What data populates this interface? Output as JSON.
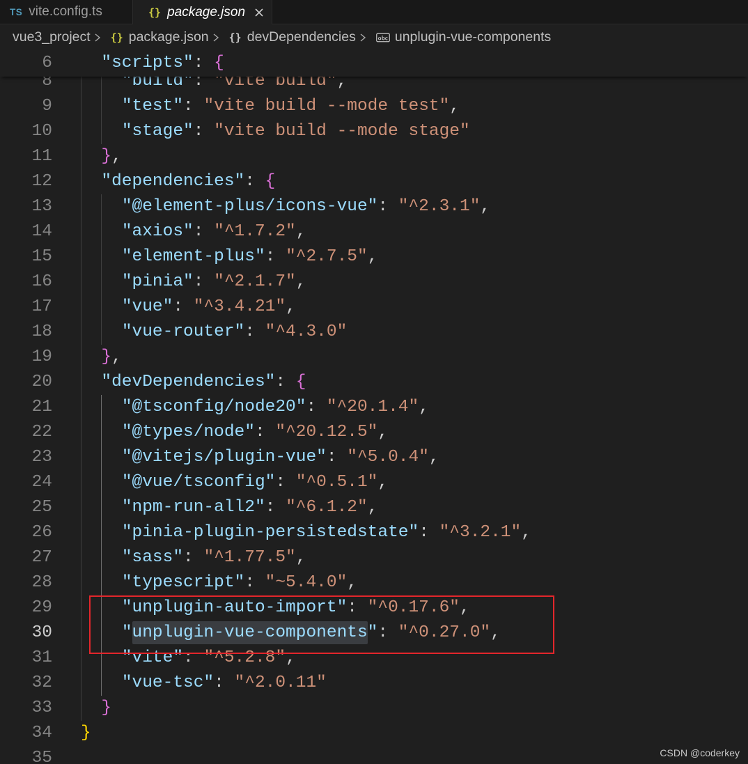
{
  "tabs": [
    {
      "icon": "typescript-file-icon",
      "icon_text": "TS",
      "label": "vite.config.ts",
      "active": false
    },
    {
      "icon": "json-file-icon",
      "icon_text": "{}",
      "label": "package.json",
      "active": true,
      "preview": true,
      "close_icon": "close-icon"
    }
  ],
  "breadcrumb": {
    "separator_icon": "chevron-right-icon",
    "folder": {
      "label": "vue3_project"
    },
    "file": {
      "icon": "json-file-icon",
      "icon_text": "{}",
      "label": "package.json"
    },
    "object": {
      "icon": "symbol-object-icon",
      "icon_text": "{}",
      "label": "devDependencies"
    },
    "property": {
      "icon": "symbol-string-icon",
      "label": "unplugin-vue-components"
    }
  },
  "editor": {
    "sticky_line": {
      "num": "6",
      "tokens": [
        {
          "ws": "  "
        },
        {
          "k": "\"scripts\""
        },
        {
          "p": ": "
        },
        {
          "b2": "{"
        }
      ]
    },
    "lines": [
      {
        "num": "8",
        "tokens": [
          {
            "ws": "    "
          },
          {
            "k": "\"build\""
          },
          {
            "p": ": "
          },
          {
            "s": "\"vite build\""
          },
          {
            "p": ","
          }
        ]
      },
      {
        "num": "9",
        "tokens": [
          {
            "ws": "    "
          },
          {
            "k": "\"test\""
          },
          {
            "p": ": "
          },
          {
            "s": "\"vite build --mode test\""
          },
          {
            "p": ","
          }
        ]
      },
      {
        "num": "10",
        "tokens": [
          {
            "ws": "    "
          },
          {
            "k": "\"stage\""
          },
          {
            "p": ": "
          },
          {
            "s": "\"vite build --mode stage\""
          }
        ]
      },
      {
        "num": "11",
        "tokens": [
          {
            "ws": "  "
          },
          {
            "b2": "}"
          },
          {
            "p": ","
          }
        ]
      },
      {
        "num": "12",
        "tokens": [
          {
            "ws": "  "
          },
          {
            "k": "\"dependencies\""
          },
          {
            "p": ": "
          },
          {
            "b2": "{"
          }
        ]
      },
      {
        "num": "13",
        "tokens": [
          {
            "ws": "    "
          },
          {
            "k": "\"@element-plus/icons-vue\""
          },
          {
            "p": ": "
          },
          {
            "s": "\"^2.3.1\""
          },
          {
            "p": ","
          }
        ]
      },
      {
        "num": "14",
        "tokens": [
          {
            "ws": "    "
          },
          {
            "k": "\"axios\""
          },
          {
            "p": ": "
          },
          {
            "s": "\"^1.7.2\""
          },
          {
            "p": ","
          }
        ]
      },
      {
        "num": "15",
        "tokens": [
          {
            "ws": "    "
          },
          {
            "k": "\"element-plus\""
          },
          {
            "p": ": "
          },
          {
            "s": "\"^2.7.5\""
          },
          {
            "p": ","
          }
        ]
      },
      {
        "num": "16",
        "tokens": [
          {
            "ws": "    "
          },
          {
            "k": "\"pinia\""
          },
          {
            "p": ": "
          },
          {
            "s": "\"^2.1.7\""
          },
          {
            "p": ","
          }
        ]
      },
      {
        "num": "17",
        "tokens": [
          {
            "ws": "    "
          },
          {
            "k": "\"vue\""
          },
          {
            "p": ": "
          },
          {
            "s": "\"^3.4.21\""
          },
          {
            "p": ","
          }
        ]
      },
      {
        "num": "18",
        "tokens": [
          {
            "ws": "    "
          },
          {
            "k": "\"vue-router\""
          },
          {
            "p": ": "
          },
          {
            "s": "\"^4.3.0\""
          }
        ]
      },
      {
        "num": "19",
        "tokens": [
          {
            "ws": "  "
          },
          {
            "b2": "}"
          },
          {
            "p": ","
          }
        ]
      },
      {
        "num": "20",
        "tokens": [
          {
            "ws": "  "
          },
          {
            "k": "\"devDependencies\""
          },
          {
            "p": ": "
          },
          {
            "b2": "{"
          }
        ]
      },
      {
        "num": "21",
        "tokens": [
          {
            "ws": "    "
          },
          {
            "k": "\"@tsconfig/node20\""
          },
          {
            "p": ": "
          },
          {
            "s": "\"^20.1.4\""
          },
          {
            "p": ","
          }
        ]
      },
      {
        "num": "22",
        "tokens": [
          {
            "ws": "    "
          },
          {
            "k": "\"@types/node\""
          },
          {
            "p": ": "
          },
          {
            "s": "\"^20.12.5\""
          },
          {
            "p": ","
          }
        ]
      },
      {
        "num": "23",
        "tokens": [
          {
            "ws": "    "
          },
          {
            "k": "\"@vitejs/plugin-vue\""
          },
          {
            "p": ": "
          },
          {
            "s": "\"^5.0.4\""
          },
          {
            "p": ","
          }
        ]
      },
      {
        "num": "24",
        "tokens": [
          {
            "ws": "    "
          },
          {
            "k": "\"@vue/tsconfig\""
          },
          {
            "p": ": "
          },
          {
            "s": "\"^0.5.1\""
          },
          {
            "p": ","
          }
        ]
      },
      {
        "num": "25",
        "tokens": [
          {
            "ws": "    "
          },
          {
            "k": "\"npm-run-all2\""
          },
          {
            "p": ": "
          },
          {
            "s": "\"^6.1.2\""
          },
          {
            "p": ","
          }
        ]
      },
      {
        "num": "26",
        "tokens": [
          {
            "ws": "    "
          },
          {
            "k": "\"pinia-plugin-persistedstate\""
          },
          {
            "p": ": "
          },
          {
            "s": "\"^3.2.1\""
          },
          {
            "p": ","
          }
        ]
      },
      {
        "num": "27",
        "tokens": [
          {
            "ws": "    "
          },
          {
            "k": "\"sass\""
          },
          {
            "p": ": "
          },
          {
            "s": "\"^1.77.5\""
          },
          {
            "p": ","
          }
        ]
      },
      {
        "num": "28",
        "tokens": [
          {
            "ws": "    "
          },
          {
            "k": "\"typescript\""
          },
          {
            "p": ": "
          },
          {
            "s": "\"~5.4.0\""
          },
          {
            "p": ","
          }
        ]
      },
      {
        "num": "29",
        "tokens": [
          {
            "ws": "    "
          },
          {
            "k": "\"unplugin-auto-import\""
          },
          {
            "p": ": "
          },
          {
            "s": "\"^0.17.6\""
          },
          {
            "p": ","
          }
        ]
      },
      {
        "num": "30",
        "active": true,
        "tokens": [
          {
            "ws": "    "
          },
          {
            "k": "\""
          },
          {
            "kh": "unplugin-vue-components"
          },
          {
            "k": "\""
          },
          {
            "p": ": "
          },
          {
            "s": "\"^0.27.0\""
          },
          {
            "p": ","
          }
        ]
      },
      {
        "num": "31",
        "tokens": [
          {
            "ws": "    "
          },
          {
            "k": "\"vite\""
          },
          {
            "p": ": "
          },
          {
            "s": "\"^5.2.8\""
          },
          {
            "p": ","
          }
        ]
      },
      {
        "num": "32",
        "tokens": [
          {
            "ws": "    "
          },
          {
            "k": "\"vue-tsc\""
          },
          {
            "p": ": "
          },
          {
            "s": "\"^2.0.11\""
          }
        ]
      },
      {
        "num": "33",
        "tokens": [
          {
            "ws": "  "
          },
          {
            "b2": "}"
          }
        ]
      },
      {
        "num": "34",
        "tokens": [
          {
            "b1": "}"
          }
        ]
      },
      {
        "num": "35",
        "tokens": []
      }
    ]
  },
  "annotation": {
    "border_color": "#e3262b"
  },
  "watermark": "CSDN @coderkey",
  "theme": {
    "editor_bg": "#1f1f1f",
    "tabbar_bg": "#181818",
    "tab_inactive_bg": "#181818",
    "tab_border": "#2b2b2b",
    "ts_icon": "#519aba",
    "json_icon": "#cbcb41",
    "key": "#9cdcfe",
    "string": "#ce9178",
    "punctuation": "#cccccc",
    "bracket_level1": "#ffd700",
    "bracket_level2": "#da70d6",
    "line_number": "#858585",
    "line_number_active": "#cccccc",
    "word_highlight": "#3a3d41",
    "indent_guide": "#404040",
    "indent_guide_active": "#707070"
  }
}
